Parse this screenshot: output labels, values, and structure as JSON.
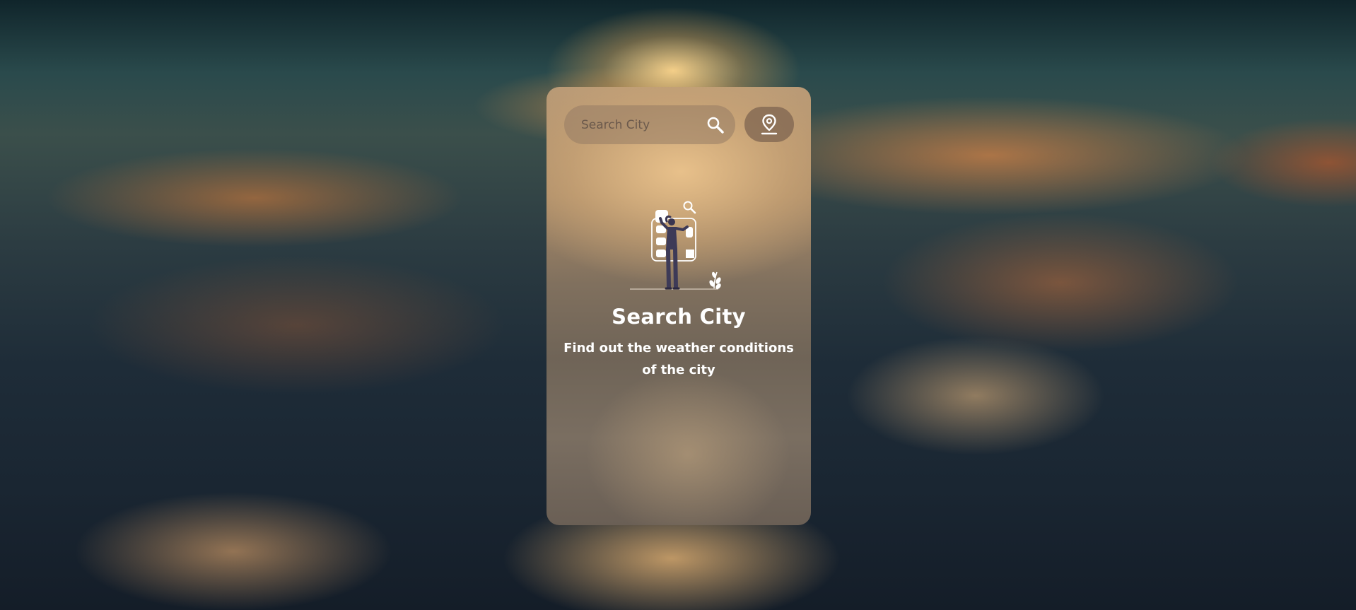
{
  "search": {
    "placeholder": "Search City",
    "value": ""
  },
  "icons": {
    "search_button": "search-icon",
    "location_button": "map-pin-icon",
    "illustration": "person-searching-city-illustration"
  },
  "empty_state": {
    "title": "Search City",
    "subtitle": "Find out the weather conditions of the city"
  },
  "colors": {
    "text": "#ffffff",
    "card_tint": "#a88a68",
    "search_bar_bg": "#967c64",
    "location_button_bg": "#7d6450"
  }
}
